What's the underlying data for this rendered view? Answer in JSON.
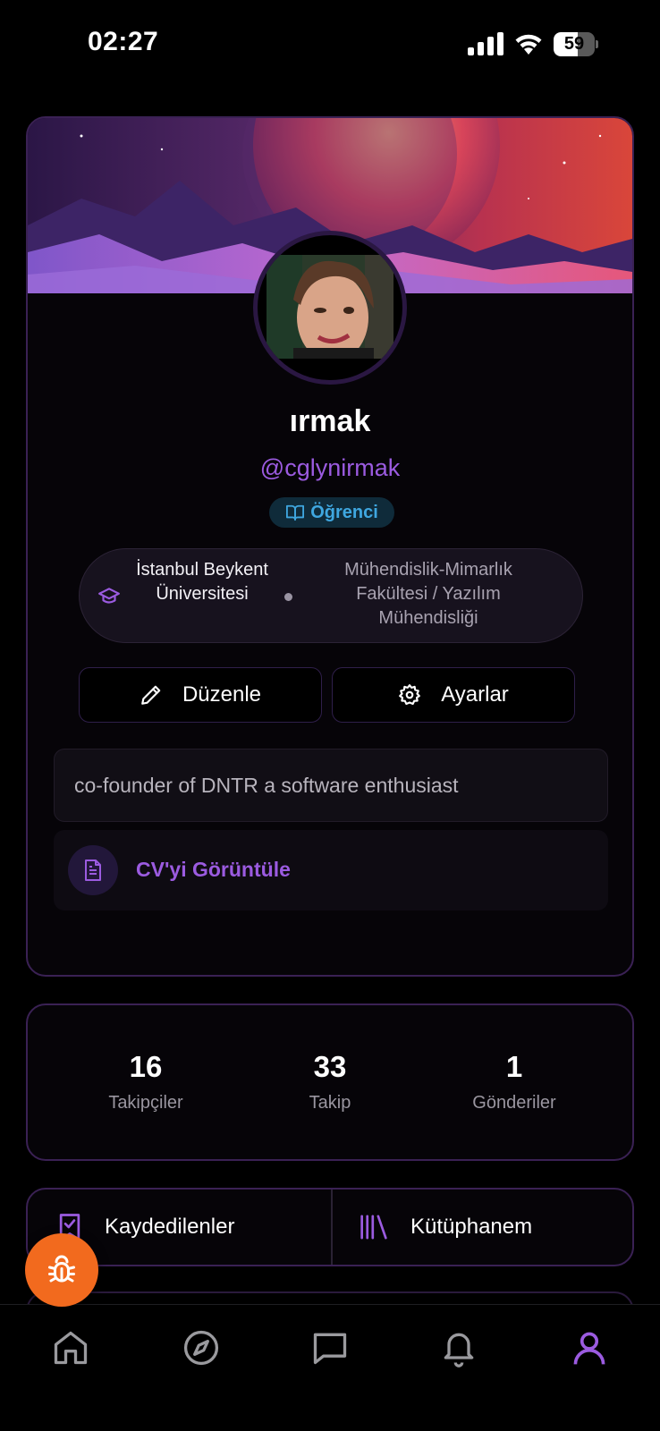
{
  "status_bar": {
    "time": "02:27",
    "battery": "59",
    "battery_level": 0.59
  },
  "profile": {
    "name": "ırmak",
    "username": "@cglynirmak",
    "role": "Öğrenci",
    "university": "İstanbul Beykent Üniversitesi",
    "department": "Mühendislik-Mimarlık Fakültesi / Yazılım Mühendisliği",
    "bio": "co-founder of DNTR a software enthusiast",
    "cv_label": "CV'yi Görüntüle"
  },
  "actions": {
    "edit_label": "Düzenle",
    "settings_label": "Ayarlar"
  },
  "stats": [
    {
      "value": "16",
      "label": "Takipçiler"
    },
    {
      "value": "33",
      "label": "Takip"
    },
    {
      "value": "1",
      "label": "Gönderiler"
    }
  ],
  "quick_links": {
    "saved_label": "Kaydedilenler",
    "library_label": "Kütüphanem"
  },
  "nav": {
    "items": [
      "home-icon",
      "explore-icon",
      "messages-icon",
      "notifications-icon",
      "profile-icon"
    ],
    "active": "profile-icon"
  },
  "colors": {
    "accent": "#9b5be0",
    "role_badge": "#3fa7e0",
    "fab": "#f26a1e",
    "card_border": "#3a2154"
  },
  "icons": {
    "role": "book-open-icon",
    "education": "graduation-cap-icon",
    "edit": "pencil-icon",
    "settings": "gear-icon",
    "cv": "file-text-icon",
    "saved": "bookmark-check-icon",
    "library": "library-icon",
    "fab": "bug-icon"
  }
}
